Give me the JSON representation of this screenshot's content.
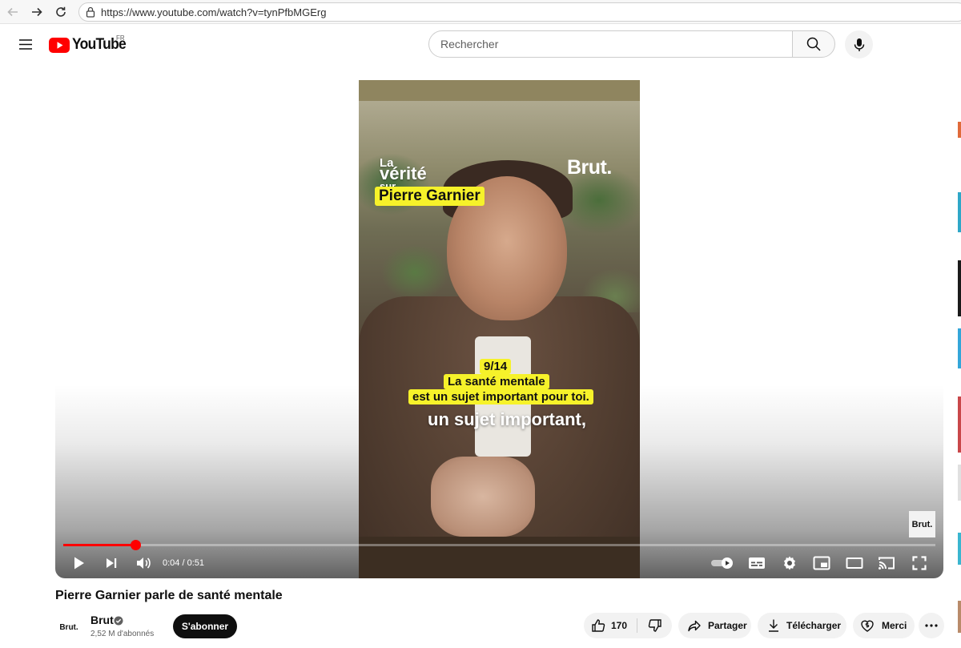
{
  "browser": {
    "url": "https://www.youtube.com/watch?v=tynPfbMGErg"
  },
  "header": {
    "logo_text": "YouTube",
    "country_code": "FR",
    "search_placeholder": "Rechercher"
  },
  "video": {
    "overlay": {
      "line1": "La",
      "line2": "vérité",
      "line3": "sur",
      "name": "Pierre Garnier",
      "watermark": "Brut.",
      "counter": "9/14",
      "caption_line1": "La santé mentale",
      "caption_line2": "est un sujet important pour toi.",
      "subtitle": "un sujet important,"
    },
    "badge_text": "Brut.",
    "current_time": "0:04",
    "duration": "0:51",
    "timecode": "0:04 / 0:51",
    "progress": 0.0828
  },
  "details": {
    "title": "Pierre Garnier parle de santé mentale",
    "channel_avatar_text": "Brut.",
    "channel_name": "Brut",
    "subscribers": "2,52 M d'abonnés",
    "subscribe_label": "S'abonner"
  },
  "actions": {
    "likes": "170",
    "share": "Partager",
    "download": "Télécharger",
    "thanks": "Merci"
  },
  "colors": {
    "accent_red": "#ff0000",
    "caption_yellow": "#f6f22a"
  }
}
